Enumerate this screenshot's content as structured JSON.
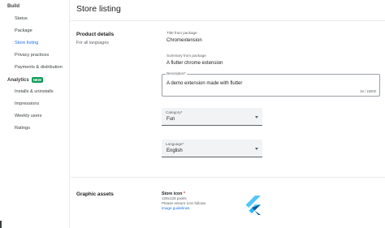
{
  "sidebar": {
    "build_heading": "Build",
    "build_items": [
      {
        "label": "Status"
      },
      {
        "label": "Package"
      },
      {
        "label": "Store listing"
      },
      {
        "label": "Privacy practices"
      },
      {
        "label": "Payments & distribution"
      }
    ],
    "analytics_heading": "Analytics",
    "analytics_badge": "NEW",
    "analytics_items": [
      {
        "label": "Installs & uninstalls"
      },
      {
        "label": "Impressions"
      },
      {
        "label": "Weekly users"
      },
      {
        "label": "Ratings"
      }
    ]
  },
  "main": {
    "title": "Store listing",
    "product_details": {
      "heading": "Product details",
      "subheading": "For all languages",
      "title_label": "Title from package",
      "title_value": "Chromextension",
      "summary_label": "Summary from package",
      "summary_value": "A flutter chrome extension",
      "description_label": "Description*",
      "description_value": "A demo extension made with flutter",
      "description_counter": "34 / 16000",
      "category_label": "Category*",
      "category_value": "Fun",
      "language_label": "Language*",
      "language_value": "English"
    },
    "graphic_assets": {
      "heading": "Graphic assets",
      "store_icon_label": "Store icon",
      "store_icon_required": "*",
      "store_icon_size": "128x128 pixels",
      "store_icon_hint": "Please ensure icon follows",
      "store_icon_link": "image guidelines"
    }
  },
  "colors": {
    "accent": "#1a73e8",
    "new_badge": "#0f9d58",
    "flutter_light": "#54c5f8",
    "flutter_dark": "#01579b"
  }
}
